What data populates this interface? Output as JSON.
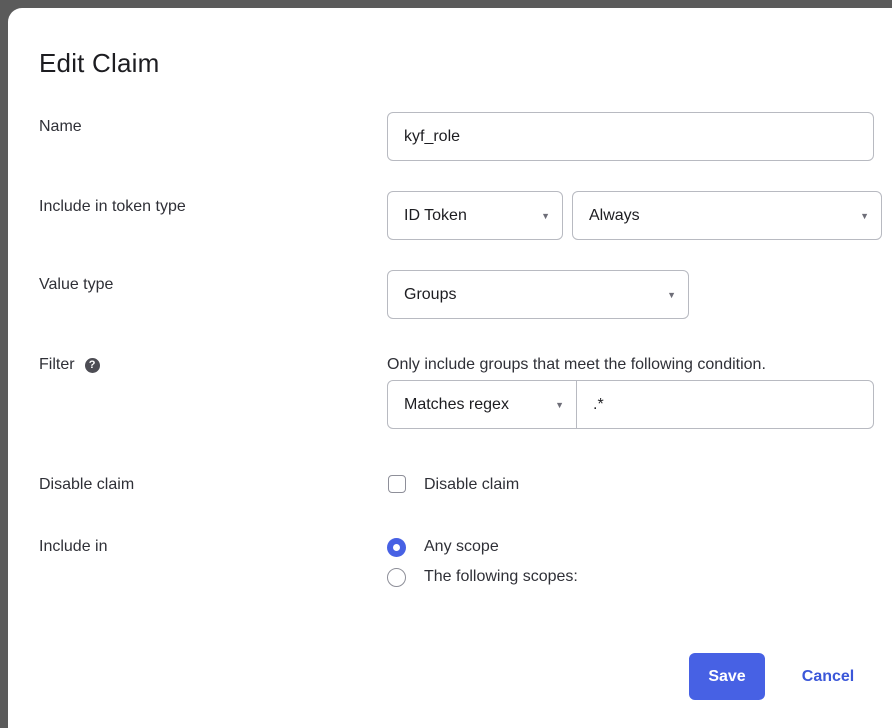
{
  "dialog": {
    "title": "Edit Claim"
  },
  "rows": {
    "name": {
      "label": "Name",
      "value": "kyf_role"
    },
    "token_type": {
      "label": "Include in token type",
      "token_value": "ID Token",
      "when_value": "Always"
    },
    "value_type": {
      "label": "Value type",
      "value": "Groups"
    },
    "filter": {
      "label": "Filter",
      "help_glyph": "?",
      "hint": "Only include groups that meet the following condition.",
      "operator": "Matches regex",
      "pattern": ".*"
    },
    "disable_claim": {
      "label": "Disable claim",
      "checkbox_label": "Disable claim",
      "checked": false
    },
    "include_in": {
      "label": "Include in",
      "options": [
        {
          "label": "Any scope",
          "selected": true
        },
        {
          "label": "The following scopes:",
          "selected": false
        }
      ]
    }
  },
  "actions": {
    "save_label": "Save",
    "cancel_label": "Cancel"
  },
  "colors": {
    "primary": "#4761e4",
    "overlay": "#5b5b5b"
  }
}
